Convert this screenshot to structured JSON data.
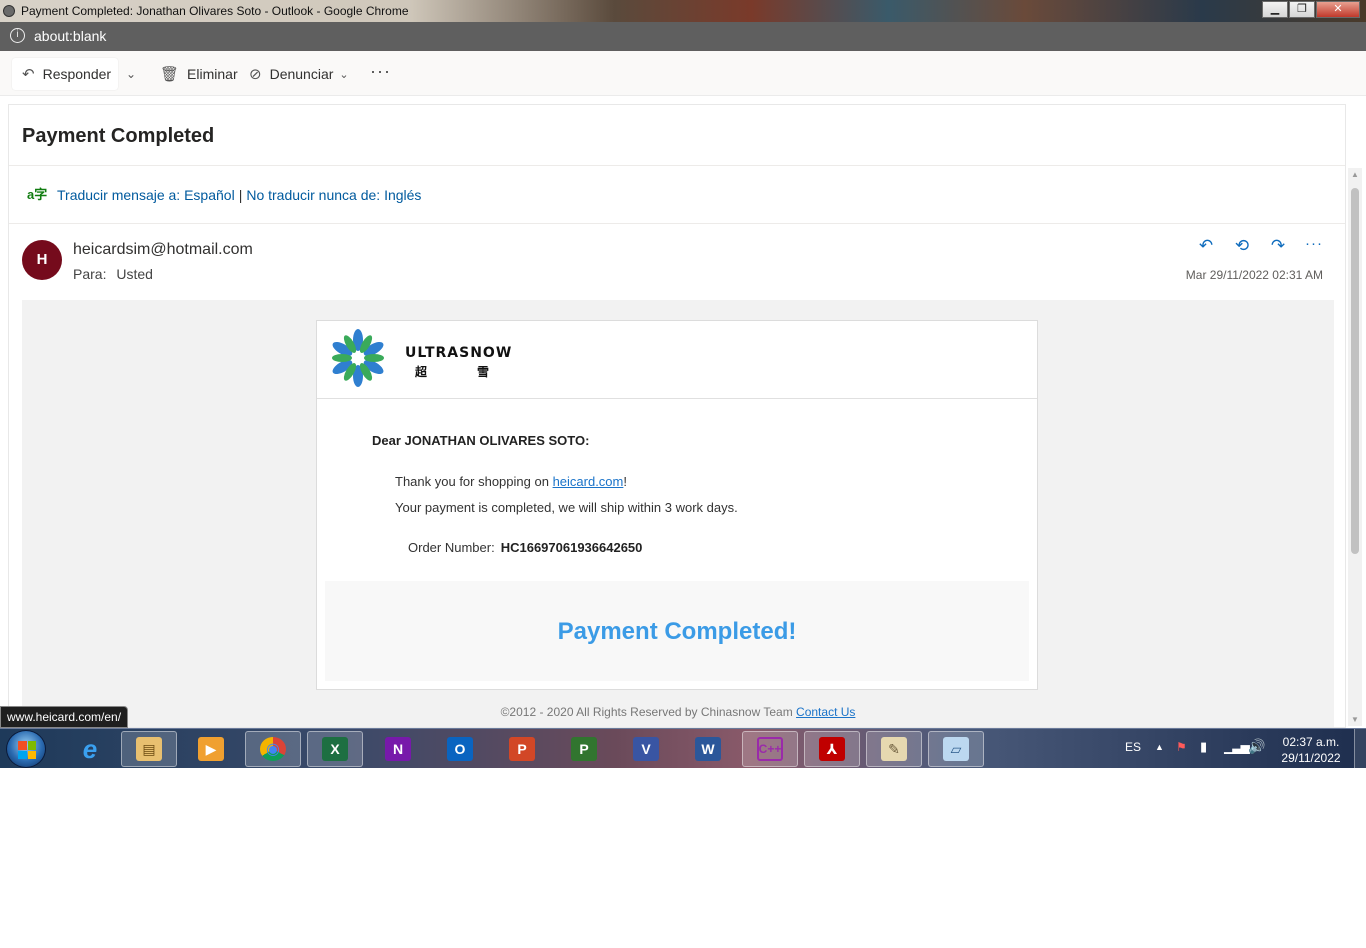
{
  "window": {
    "title": "Payment Completed: Jonathan Olivares Soto - Outlook - Google Chrome",
    "minimize": "▁",
    "maximize": "❐",
    "close": "✕"
  },
  "address_bar": {
    "url": "about:blank"
  },
  "toolbar": {
    "reply_label": "Responder",
    "delete_label": "Eliminar",
    "report_label": "Denunciar",
    "more_label": "···"
  },
  "message": {
    "subject": "Payment Completed",
    "translate": {
      "translate_link": "Traducir mensaje a: Español",
      "separator": "|",
      "never_link": "No traducir nunca de: Inglés"
    },
    "sender_initial": "H",
    "sender": "heicardsim@hotmail.com",
    "to_label": "Para:",
    "to_value": "Usted",
    "date": "Mar 29/11/2022 02:31 AM",
    "more_actions": "···"
  },
  "email": {
    "logo_text": "ULTRASNOW",
    "logo_cn": "超雪",
    "greeting": "Dear JONATHAN OLIVARES SOTO:",
    "thanks_prefix": "Thank you for shopping on ",
    "thanks_link": "heicard.com",
    "thanks_suffix": "!",
    "shipping": "Your payment is completed, we will ship within 3 work days.",
    "order_label": "Order Number:",
    "order_number": "HC16697061936642650",
    "completed_title": "Payment Completed!",
    "footer_text": "©2012 - 2020 All Rights Reserved by Chinasnow Team ",
    "footer_link": "Contact Us"
  },
  "status_link": "www.heicard.com/en/",
  "taskbar": {
    "apps": [
      {
        "name": "internet-explorer",
        "glyph": "e"
      },
      {
        "name": "file-explorer",
        "glyph": "▤"
      },
      {
        "name": "media-player",
        "glyph": "▶"
      },
      {
        "name": "chrome",
        "glyph": "◉"
      },
      {
        "name": "excel",
        "glyph": "X"
      },
      {
        "name": "onenote",
        "glyph": "N"
      },
      {
        "name": "outlook",
        "glyph": "O"
      },
      {
        "name": "powerpoint",
        "glyph": "P"
      },
      {
        "name": "project",
        "glyph": "P"
      },
      {
        "name": "visio",
        "glyph": "V"
      },
      {
        "name": "word",
        "glyph": "W"
      },
      {
        "name": "cpp-editor",
        "glyph": "C++"
      },
      {
        "name": "acrobat",
        "glyph": "⅄"
      },
      {
        "name": "paint",
        "glyph": "✎"
      },
      {
        "name": "notes",
        "glyph": "▱"
      }
    ],
    "language": "ES",
    "time": "02:37 a.m.",
    "date": "29/11/2022"
  }
}
